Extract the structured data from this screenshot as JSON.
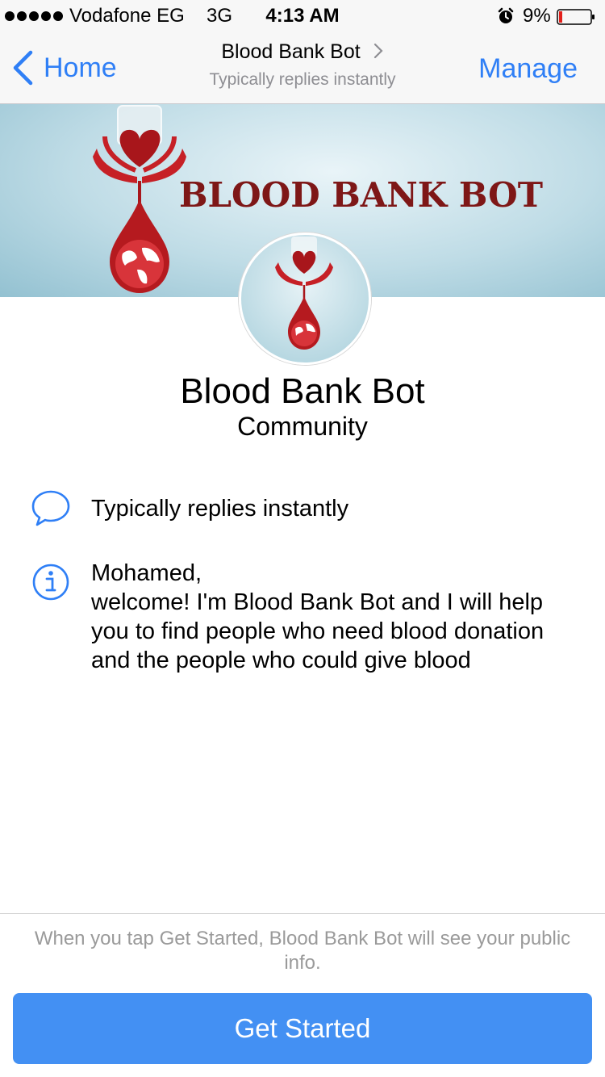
{
  "status_bar": {
    "carrier": "Vodafone EG",
    "network": "3G",
    "time": "4:13 AM",
    "battery": "9%",
    "signal_bars": 5,
    "icons": [
      "signal-dots-icon",
      "alarm-clock-icon",
      "battery-low-icon"
    ]
  },
  "nav": {
    "back_label": "Home",
    "title": "Blood Bank Bot",
    "subtitle": "Typically replies instantly",
    "manage_label": "Manage",
    "accent_color": "#2f7ff6"
  },
  "cover": {
    "title": "BLOOD BANK BOT",
    "title_color": "#7e1717"
  },
  "page": {
    "name": "Blood Bank Bot",
    "category": "Community",
    "reply_info": "Typically replies instantly",
    "about_name": "Mohamed,",
    "about_text": "welcome! I'm Blood Bank Bot and I will help you to find people who need blood donation and the people who could give blood",
    "icons": [
      "chat-bubble-icon",
      "info-icon"
    ]
  },
  "footer": {
    "note": "When you tap Get Started, Blood Bank Bot will see your public info.",
    "button_label": "Get Started",
    "button_color": "#4390f3"
  }
}
